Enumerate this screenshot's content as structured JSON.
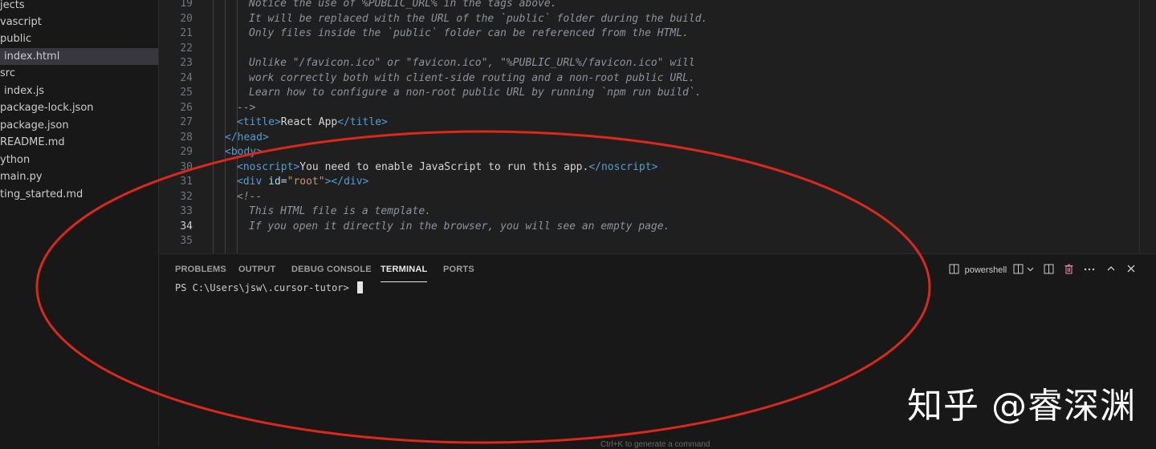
{
  "sidebar": {
    "items": [
      {
        "label": "jects"
      },
      {
        "label": "vascript"
      },
      {
        "label": "public"
      },
      {
        "label": "index.html"
      },
      {
        "label": "src"
      },
      {
        "label": "index.js"
      },
      {
        "label": "package-lock.json"
      },
      {
        "label": "package.json"
      },
      {
        "label": "README.md"
      },
      {
        "label": "ython"
      },
      {
        "label": "main.py"
      },
      {
        "label": "ting_started.md"
      }
    ]
  },
  "editor": {
    "lines": [
      {
        "n": "19",
        "text": "Notice the use of %PUBLIC_URL% in the tags above."
      },
      {
        "n": "20",
        "text": "It will be replaced with the URL of the `public` folder during the build."
      },
      {
        "n": "21",
        "text": "Only files inside the `public` folder can be referenced from the HTML."
      },
      {
        "n": "22",
        "text": ""
      },
      {
        "n": "23",
        "text": "Unlike \"/favicon.ico\" or \"favicon.ico\", \"%PUBLIC_URL%/favicon.ico\" will"
      },
      {
        "n": "24",
        "text": "work correctly both with client-side routing and a non-root public URL."
      },
      {
        "n": "25",
        "text": "Learn how to configure a non-root public URL by running `npm run build`."
      },
      {
        "n": "26",
        "text": "-->"
      },
      {
        "n": "27",
        "open": "<title>",
        "inner": "React App",
        "close": "</title>"
      },
      {
        "n": "28",
        "text": "</head>"
      },
      {
        "n": "29",
        "text": "<body>"
      },
      {
        "n": "30",
        "open": "<noscript>",
        "inner": "You need to enable JavaScript to run this app.",
        "close": "</noscript>"
      },
      {
        "n": "31",
        "tag": "div",
        "attr": "id",
        "value": "\"root\"",
        "close": "</div>"
      },
      {
        "n": "32",
        "text": "<!--"
      },
      {
        "n": "33",
        "text": "This HTML file is a template."
      },
      {
        "n": "34",
        "text": "If you open it directly in the browser, you will see an empty page."
      },
      {
        "n": "35",
        "text": ""
      }
    ],
    "active_line": "34"
  },
  "panel": {
    "tabs": [
      "PROBLEMS",
      "OUTPUT",
      "DEBUG CONSOLE",
      "TERMINAL",
      "PORTS"
    ],
    "active_tab": "TERMINAL",
    "shell_label": "powershell",
    "prompt": "PS C:\\Users\\jsw\\.cursor-tutor> ",
    "hint": "Ctrl+K to generate a command"
  },
  "watermark": "知乎 @睿深渊",
  "colors": {
    "annotation_ellipse": "#d9281c",
    "editor_bg": "#1f1f1f",
    "panel_bg": "#181818",
    "tag": "#569cd6",
    "string": "#ce9178",
    "attribute": "#9cdcfe",
    "comment": "#8b949e"
  },
  "icons": [
    "terminal-icon",
    "split-terminal-icon",
    "chevron-down-icon",
    "layout-icon",
    "trash-icon",
    "more-icon",
    "chevron-up-icon",
    "close-icon"
  ]
}
